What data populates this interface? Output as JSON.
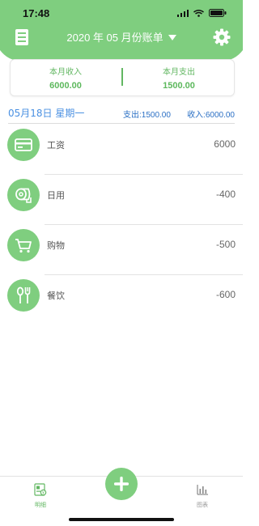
{
  "status": {
    "time": "17:48"
  },
  "header": {
    "title": "2020 年 05 月份账单"
  },
  "summary": {
    "income_label": "本月收入",
    "income_value": "6000.00",
    "expense_label": "本月支出",
    "expense_value": "1500.00"
  },
  "day": {
    "date": "05月18日 星期一",
    "expense": "支出:1500.00",
    "income": "收入:6000.00"
  },
  "items": [
    {
      "icon": "card-icon",
      "label": "工资",
      "amount": "6000"
    },
    {
      "icon": "tissue-roll-icon",
      "label": "日用",
      "amount": "-400"
    },
    {
      "icon": "shopping-cart-icon",
      "label": "购物",
      "amount": "-500"
    },
    {
      "icon": "spoon-fork-icon",
      "label": "餐饮",
      "amount": "-600"
    }
  ],
  "tabbar": {
    "details_label": "明细",
    "chart_label": "图表"
  },
  "colors": {
    "accent": "#7fce7f",
    "blue": "#4a90e2"
  }
}
